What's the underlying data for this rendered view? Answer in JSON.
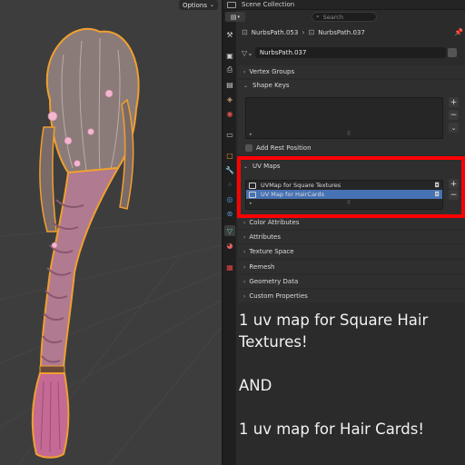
{
  "viewport": {
    "options_label": "Options"
  },
  "properties": {
    "header_title": "Scene Collection",
    "search_placeholder": "Search",
    "breadcrumb": {
      "object": "NurbsPath.053",
      "data": "NurbsPath.037"
    },
    "data_block_name": "NurbsPath.037",
    "panels": {
      "vertex_groups": "Vertex Groups",
      "shape_keys": "Shape Keys",
      "add_rest_position": "Add Rest Position",
      "uv_maps": "UV Maps",
      "color_attributes": "Color Attributes",
      "attributes": "Attributes",
      "texture_space": "Texture Space",
      "remesh": "Remesh",
      "geometry_data": "Geometry Data",
      "custom_properties": "Custom Properties"
    },
    "uv_maps": [
      {
        "name": "UVMap for Square Textures",
        "selected": false
      },
      {
        "name": "UV Map for HairCards",
        "selected": true
      }
    ],
    "selection_color": "#4772b3"
  },
  "annotation": {
    "highlight_color": "#ff0000",
    "line1": "1 uv map for Square Hair",
    "line2": "Textures!",
    "line3": "AND",
    "line4": "1 uv map for Hair Cards!"
  }
}
